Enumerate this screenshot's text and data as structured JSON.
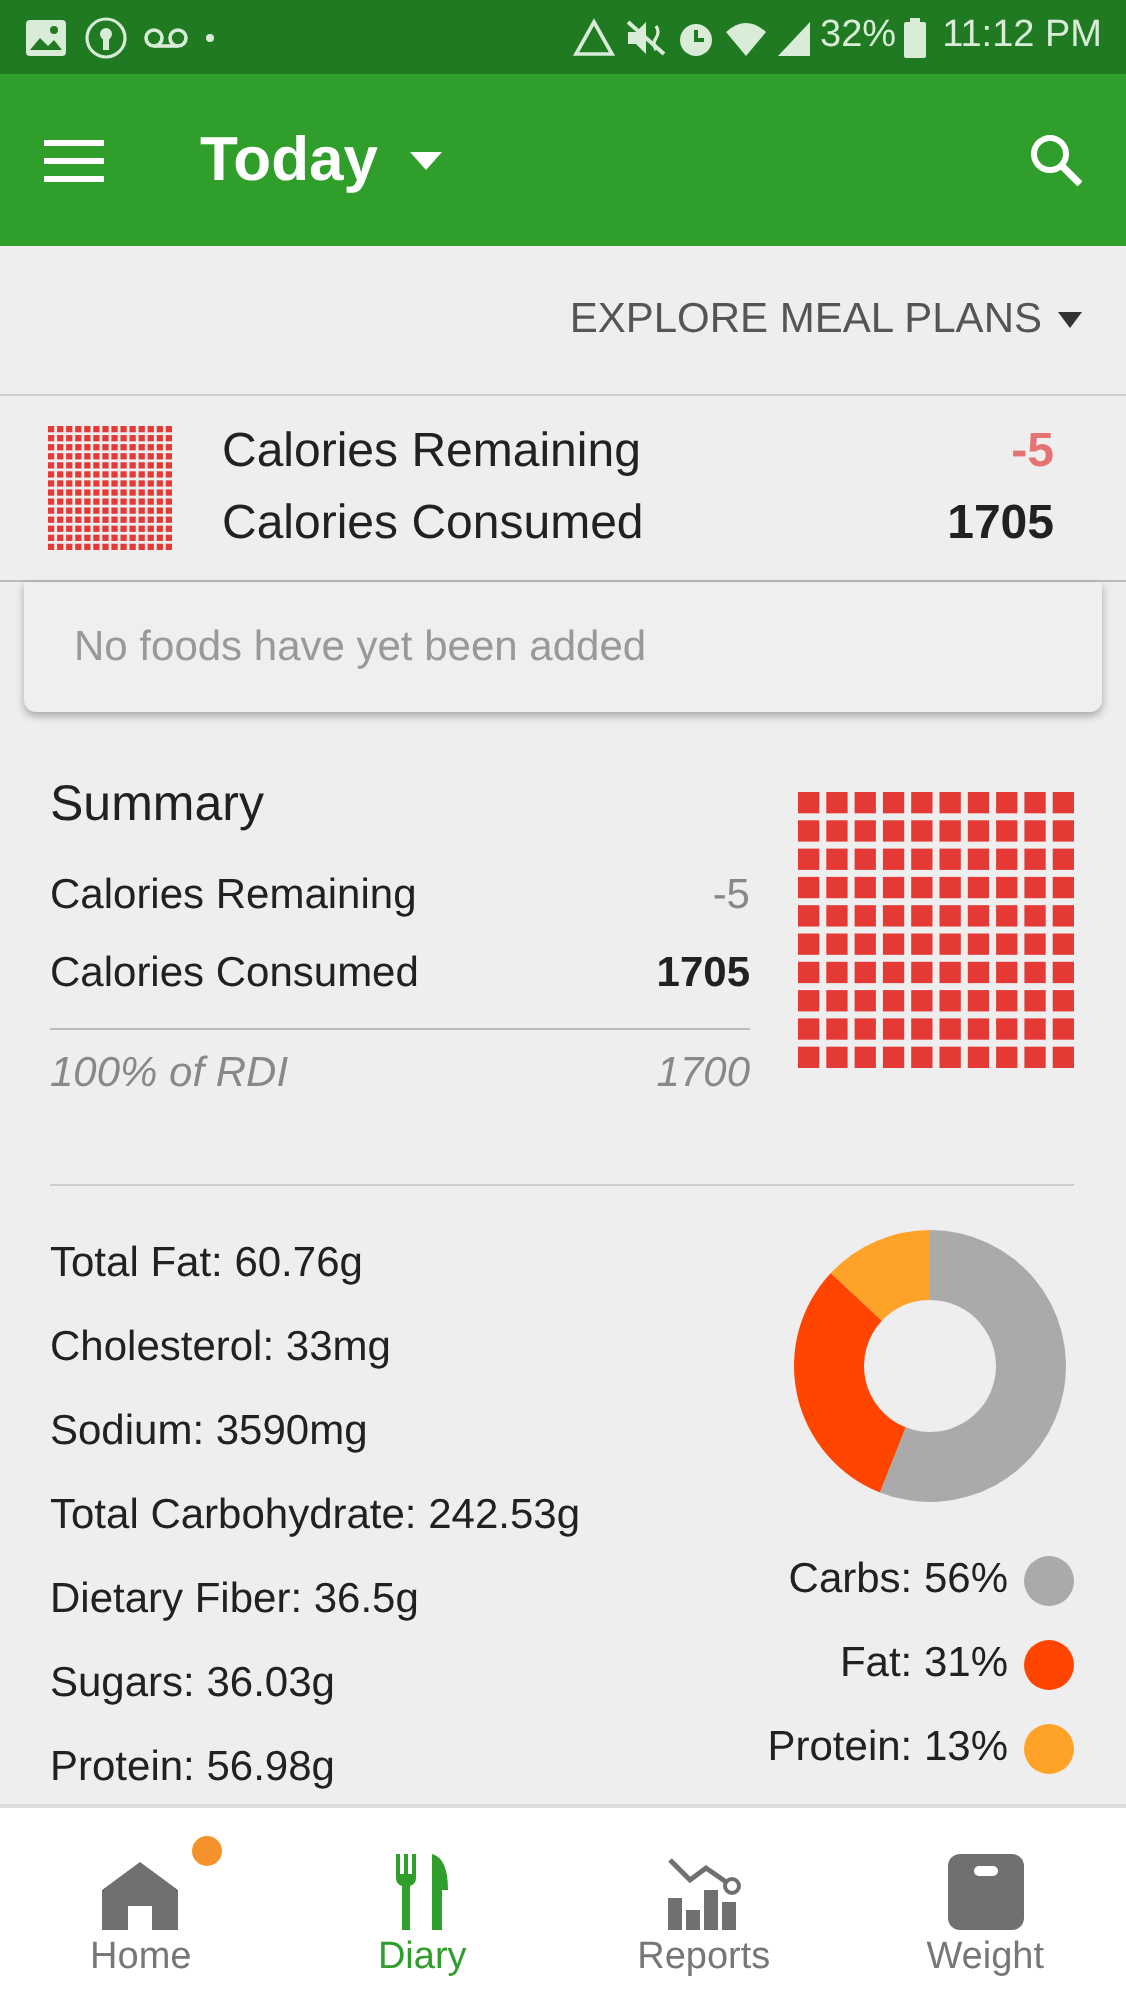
{
  "status_bar": {
    "battery": "32%",
    "time": "11:12 PM"
  },
  "app_bar": {
    "title": "Today"
  },
  "explore": {
    "label": "EXPLORE MEAL PLANS"
  },
  "calories_card": {
    "rows": [
      {
        "label": "Calories Remaining",
        "value": "-5",
        "kind": "remaining"
      },
      {
        "label": "Calories Consumed",
        "value": "1705",
        "kind": "consumed"
      }
    ]
  },
  "foods_card": {
    "message": "No foods have yet been added"
  },
  "summary": {
    "title": "Summary",
    "rows": [
      {
        "label": "Calories Remaining",
        "value": "-5",
        "kind": "remaining"
      },
      {
        "label": "Calories Consumed",
        "value": "1705",
        "kind": "consumed"
      }
    ],
    "rdi": {
      "label": "100% of RDI",
      "value": "1700"
    }
  },
  "nutrients": [
    "Total Fat: 60.76g",
    "Cholesterol: 33mg",
    "Sodium: 3590mg",
    "Total Carbohydrate: 242.53g",
    "Dietary Fiber: 36.5g",
    "Sugars: 36.03g",
    "Protein: 56.98g"
  ],
  "macros": {
    "chart_data": {
      "type": "donut",
      "categories": [
        "Carbs: 56%",
        "Fat: 31%",
        "Protein: 13%"
      ],
      "values": [
        56,
        31,
        13
      ]
    },
    "legend": [
      {
        "color": "#aaaaaa"
      },
      {
        "color": "#ff4500"
      },
      {
        "color": "#ffa228"
      }
    ]
  },
  "bottom_nav": [
    {
      "label": "Home",
      "selected": false,
      "notification": true
    },
    {
      "label": "Diary",
      "selected": true,
      "notification": false
    },
    {
      "label": "Reports",
      "selected": false,
      "notification": false
    },
    {
      "label": "Weight",
      "selected": false,
      "notification": false
    }
  ]
}
